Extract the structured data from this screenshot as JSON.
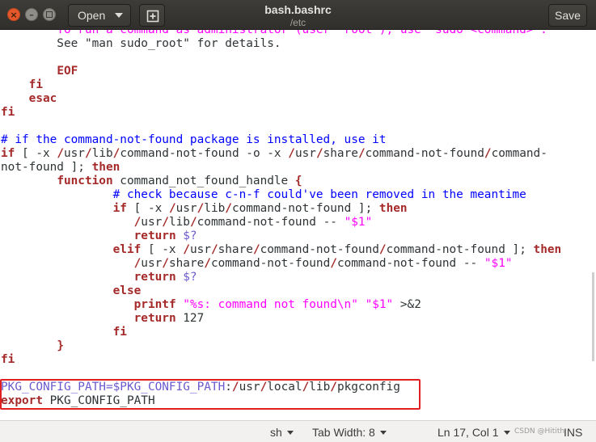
{
  "window": {
    "title": "bash.bashrc",
    "subtitle": "/etc",
    "open_label": "Open",
    "save_label": "Save"
  },
  "editor": {
    "lines": [
      {
        "tokens": [
          {
            "t": "        To run a command as administrator (user \"root\"), use \"sudo <command>\".",
            "c": "str"
          }
        ]
      },
      {
        "tokens": [
          {
            "t": "        See \"man sudo_root\" for details.",
            "c": "plain"
          }
        ]
      },
      {
        "tokens": [
          {
            "t": "",
            "c": "plain"
          }
        ]
      },
      {
        "tokens": [
          {
            "t": "        ",
            "c": "plain"
          },
          {
            "t": "EOF",
            "c": "kw"
          }
        ]
      },
      {
        "tokens": [
          {
            "t": "    ",
            "c": "plain"
          },
          {
            "t": "fi",
            "c": "kw"
          }
        ]
      },
      {
        "tokens": [
          {
            "t": "    ",
            "c": "plain"
          },
          {
            "t": "esac",
            "c": "kw"
          }
        ]
      },
      {
        "tokens": [
          {
            "t": "fi",
            "c": "kw"
          }
        ]
      },
      {
        "tokens": [
          {
            "t": "",
            "c": "plain"
          }
        ]
      },
      {
        "tokens": [
          {
            "t": "# if the command-not-found package is installed, use it",
            "c": "cm"
          }
        ]
      },
      {
        "tokens": [
          {
            "t": "if",
            "c": "kw"
          },
          {
            "t": " [ -x ",
            "c": "plain"
          },
          {
            "t": "/",
            "c": "sep"
          },
          {
            "t": "usr",
            "c": "plain"
          },
          {
            "t": "/",
            "c": "sep"
          },
          {
            "t": "lib",
            "c": "plain"
          },
          {
            "t": "/",
            "c": "sep"
          },
          {
            "t": "command-not-found -o -x ",
            "c": "plain"
          },
          {
            "t": "/",
            "c": "sep"
          },
          {
            "t": "usr",
            "c": "plain"
          },
          {
            "t": "/",
            "c": "sep"
          },
          {
            "t": "share",
            "c": "plain"
          },
          {
            "t": "/",
            "c": "sep"
          },
          {
            "t": "command-not-found",
            "c": "plain"
          },
          {
            "t": "/",
            "c": "sep"
          },
          {
            "t": "command-",
            "c": "plain"
          }
        ]
      },
      {
        "tokens": [
          {
            "t": "not-found ]; ",
            "c": "plain"
          },
          {
            "t": "then",
            "c": "kw"
          }
        ]
      },
      {
        "tokens": [
          {
            "t": "        ",
            "c": "plain"
          },
          {
            "t": "function",
            "c": "kw"
          },
          {
            "t": " command_not_found_handle ",
            "c": "plain"
          },
          {
            "t": "{",
            "c": "kw"
          }
        ]
      },
      {
        "tokens": [
          {
            "t": "                ",
            "c": "plain"
          },
          {
            "t": "# check because c-n-f could've been removed in the meantime",
            "c": "cm"
          }
        ]
      },
      {
        "tokens": [
          {
            "t": "                ",
            "c": "plain"
          },
          {
            "t": "if",
            "c": "kw"
          },
          {
            "t": " [ -x ",
            "c": "plain"
          },
          {
            "t": "/",
            "c": "sep"
          },
          {
            "t": "usr",
            "c": "plain"
          },
          {
            "t": "/",
            "c": "sep"
          },
          {
            "t": "lib",
            "c": "plain"
          },
          {
            "t": "/",
            "c": "sep"
          },
          {
            "t": "command-not-found ]; ",
            "c": "plain"
          },
          {
            "t": "then",
            "c": "kw"
          }
        ]
      },
      {
        "tokens": [
          {
            "t": "                   ",
            "c": "plain"
          },
          {
            "t": "/",
            "c": "sep"
          },
          {
            "t": "usr",
            "c": "plain"
          },
          {
            "t": "/",
            "c": "sep"
          },
          {
            "t": "lib",
            "c": "plain"
          },
          {
            "t": "/",
            "c": "sep"
          },
          {
            "t": "command-not-found -- ",
            "c": "plain"
          },
          {
            "t": "\"$1\"",
            "c": "str"
          }
        ]
      },
      {
        "tokens": [
          {
            "t": "                   ",
            "c": "plain"
          },
          {
            "t": "return",
            "c": "kw"
          },
          {
            "t": " $?",
            "c": "var"
          }
        ]
      },
      {
        "tokens": [
          {
            "t": "                ",
            "c": "plain"
          },
          {
            "t": "elif",
            "c": "kw"
          },
          {
            "t": " [ -x ",
            "c": "plain"
          },
          {
            "t": "/",
            "c": "sep"
          },
          {
            "t": "usr",
            "c": "plain"
          },
          {
            "t": "/",
            "c": "sep"
          },
          {
            "t": "share",
            "c": "plain"
          },
          {
            "t": "/",
            "c": "sep"
          },
          {
            "t": "command-not-found",
            "c": "plain"
          },
          {
            "t": "/",
            "c": "sep"
          },
          {
            "t": "command-not-found ]; ",
            "c": "plain"
          },
          {
            "t": "then",
            "c": "kw"
          }
        ]
      },
      {
        "tokens": [
          {
            "t": "                   ",
            "c": "plain"
          },
          {
            "t": "/",
            "c": "sep"
          },
          {
            "t": "usr",
            "c": "plain"
          },
          {
            "t": "/",
            "c": "sep"
          },
          {
            "t": "share",
            "c": "plain"
          },
          {
            "t": "/",
            "c": "sep"
          },
          {
            "t": "command-not-found",
            "c": "plain"
          },
          {
            "t": "/",
            "c": "sep"
          },
          {
            "t": "command-not-found -- ",
            "c": "plain"
          },
          {
            "t": "\"$1\"",
            "c": "str"
          }
        ]
      },
      {
        "tokens": [
          {
            "t": "                   ",
            "c": "plain"
          },
          {
            "t": "return",
            "c": "kw"
          },
          {
            "t": " $?",
            "c": "var"
          }
        ]
      },
      {
        "tokens": [
          {
            "t": "                ",
            "c": "plain"
          },
          {
            "t": "else",
            "c": "kw"
          }
        ]
      },
      {
        "tokens": [
          {
            "t": "                   ",
            "c": "plain"
          },
          {
            "t": "printf",
            "c": "kw"
          },
          {
            "t": " ",
            "c": "plain"
          },
          {
            "t": "\"%s: command not found\\n\"",
            "c": "str"
          },
          {
            "t": " ",
            "c": "plain"
          },
          {
            "t": "\"$1\"",
            "c": "str"
          },
          {
            "t": " >&2",
            "c": "plain"
          }
        ]
      },
      {
        "tokens": [
          {
            "t": "                   ",
            "c": "plain"
          },
          {
            "t": "return",
            "c": "kw"
          },
          {
            "t": " 127",
            "c": "plain"
          }
        ]
      },
      {
        "tokens": [
          {
            "t": "                ",
            "c": "plain"
          },
          {
            "t": "fi",
            "c": "kw"
          }
        ]
      },
      {
        "tokens": [
          {
            "t": "        ",
            "c": "plain"
          },
          {
            "t": "}",
            "c": "kw"
          }
        ]
      },
      {
        "tokens": [
          {
            "t": "fi",
            "c": "kw"
          }
        ]
      },
      {
        "tokens": [
          {
            "t": "",
            "c": "plain"
          }
        ]
      },
      {
        "tokens": [
          {
            "t": "PKG_CONFIG_PATH=$PKG_CONFIG_PATH",
            "c": "var"
          },
          {
            "t": ":",
            "c": "plain"
          },
          {
            "t": "/",
            "c": "sep"
          },
          {
            "t": "usr",
            "c": "plain"
          },
          {
            "t": "/",
            "c": "sep"
          },
          {
            "t": "local",
            "c": "plain"
          },
          {
            "t": "/",
            "c": "sep"
          },
          {
            "t": "lib",
            "c": "plain"
          },
          {
            "t": "/",
            "c": "sep"
          },
          {
            "t": "pkgconfig",
            "c": "plain"
          }
        ]
      },
      {
        "tokens": [
          {
            "t": "export",
            "c": "kw"
          },
          {
            "t": " PKG_CONFIG_PATH",
            "c": "plain"
          }
        ]
      }
    ]
  },
  "statusbar": {
    "language": "sh",
    "tab_width": "Tab Width: 8",
    "position": "Ln 17, Col 1",
    "mode": "INS",
    "watermark": "CSDN @Hitith"
  },
  "colors": {
    "keyword": "#a52a2a",
    "comment": "#0000ff",
    "string": "#ff00ff",
    "variable": "#6a5acd",
    "highlight_box": "#e02020",
    "close_button": "#e3572a"
  },
  "icons": {
    "close": "close-icon",
    "minimize": "minimize-icon",
    "maximize": "maximize-icon",
    "new_document": "new-document-icon",
    "dropdown": "chevron-down-icon"
  }
}
